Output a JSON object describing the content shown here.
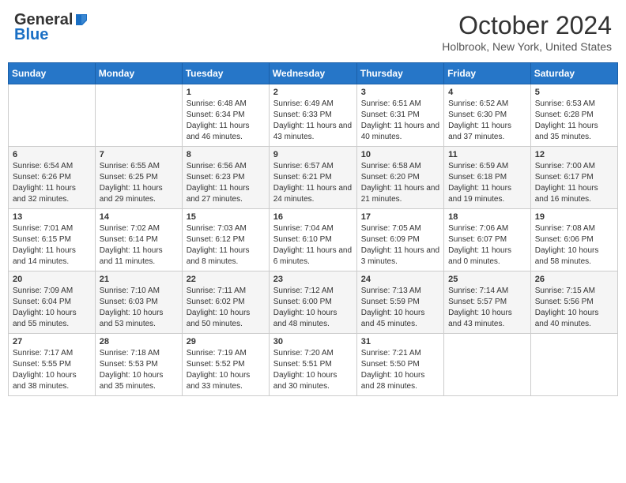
{
  "header": {
    "logo_general": "General",
    "logo_blue": "Blue",
    "title": "October 2024",
    "location": "Holbrook, New York, United States"
  },
  "weekdays": [
    "Sunday",
    "Monday",
    "Tuesday",
    "Wednesday",
    "Thursday",
    "Friday",
    "Saturday"
  ],
  "weeks": [
    [
      {
        "day": "",
        "info": ""
      },
      {
        "day": "",
        "info": ""
      },
      {
        "day": "1",
        "info": "Sunrise: 6:48 AM\nSunset: 6:34 PM\nDaylight: 11 hours and 46 minutes."
      },
      {
        "day": "2",
        "info": "Sunrise: 6:49 AM\nSunset: 6:33 PM\nDaylight: 11 hours and 43 minutes."
      },
      {
        "day": "3",
        "info": "Sunrise: 6:51 AM\nSunset: 6:31 PM\nDaylight: 11 hours and 40 minutes."
      },
      {
        "day": "4",
        "info": "Sunrise: 6:52 AM\nSunset: 6:30 PM\nDaylight: 11 hours and 37 minutes."
      },
      {
        "day": "5",
        "info": "Sunrise: 6:53 AM\nSunset: 6:28 PM\nDaylight: 11 hours and 35 minutes."
      }
    ],
    [
      {
        "day": "6",
        "info": "Sunrise: 6:54 AM\nSunset: 6:26 PM\nDaylight: 11 hours and 32 minutes."
      },
      {
        "day": "7",
        "info": "Sunrise: 6:55 AM\nSunset: 6:25 PM\nDaylight: 11 hours and 29 minutes."
      },
      {
        "day": "8",
        "info": "Sunrise: 6:56 AM\nSunset: 6:23 PM\nDaylight: 11 hours and 27 minutes."
      },
      {
        "day": "9",
        "info": "Sunrise: 6:57 AM\nSunset: 6:21 PM\nDaylight: 11 hours and 24 minutes."
      },
      {
        "day": "10",
        "info": "Sunrise: 6:58 AM\nSunset: 6:20 PM\nDaylight: 11 hours and 21 minutes."
      },
      {
        "day": "11",
        "info": "Sunrise: 6:59 AM\nSunset: 6:18 PM\nDaylight: 11 hours and 19 minutes."
      },
      {
        "day": "12",
        "info": "Sunrise: 7:00 AM\nSunset: 6:17 PM\nDaylight: 11 hours and 16 minutes."
      }
    ],
    [
      {
        "day": "13",
        "info": "Sunrise: 7:01 AM\nSunset: 6:15 PM\nDaylight: 11 hours and 14 minutes."
      },
      {
        "day": "14",
        "info": "Sunrise: 7:02 AM\nSunset: 6:14 PM\nDaylight: 11 hours and 11 minutes."
      },
      {
        "day": "15",
        "info": "Sunrise: 7:03 AM\nSunset: 6:12 PM\nDaylight: 11 hours and 8 minutes."
      },
      {
        "day": "16",
        "info": "Sunrise: 7:04 AM\nSunset: 6:10 PM\nDaylight: 11 hours and 6 minutes."
      },
      {
        "day": "17",
        "info": "Sunrise: 7:05 AM\nSunset: 6:09 PM\nDaylight: 11 hours and 3 minutes."
      },
      {
        "day": "18",
        "info": "Sunrise: 7:06 AM\nSunset: 6:07 PM\nDaylight: 11 hours and 0 minutes."
      },
      {
        "day": "19",
        "info": "Sunrise: 7:08 AM\nSunset: 6:06 PM\nDaylight: 10 hours and 58 minutes."
      }
    ],
    [
      {
        "day": "20",
        "info": "Sunrise: 7:09 AM\nSunset: 6:04 PM\nDaylight: 10 hours and 55 minutes."
      },
      {
        "day": "21",
        "info": "Sunrise: 7:10 AM\nSunset: 6:03 PM\nDaylight: 10 hours and 53 minutes."
      },
      {
        "day": "22",
        "info": "Sunrise: 7:11 AM\nSunset: 6:02 PM\nDaylight: 10 hours and 50 minutes."
      },
      {
        "day": "23",
        "info": "Sunrise: 7:12 AM\nSunset: 6:00 PM\nDaylight: 10 hours and 48 minutes."
      },
      {
        "day": "24",
        "info": "Sunrise: 7:13 AM\nSunset: 5:59 PM\nDaylight: 10 hours and 45 minutes."
      },
      {
        "day": "25",
        "info": "Sunrise: 7:14 AM\nSunset: 5:57 PM\nDaylight: 10 hours and 43 minutes."
      },
      {
        "day": "26",
        "info": "Sunrise: 7:15 AM\nSunset: 5:56 PM\nDaylight: 10 hours and 40 minutes."
      }
    ],
    [
      {
        "day": "27",
        "info": "Sunrise: 7:17 AM\nSunset: 5:55 PM\nDaylight: 10 hours and 38 minutes."
      },
      {
        "day": "28",
        "info": "Sunrise: 7:18 AM\nSunset: 5:53 PM\nDaylight: 10 hours and 35 minutes."
      },
      {
        "day": "29",
        "info": "Sunrise: 7:19 AM\nSunset: 5:52 PM\nDaylight: 10 hours and 33 minutes."
      },
      {
        "day": "30",
        "info": "Sunrise: 7:20 AM\nSunset: 5:51 PM\nDaylight: 10 hours and 30 minutes."
      },
      {
        "day": "31",
        "info": "Sunrise: 7:21 AM\nSunset: 5:50 PM\nDaylight: 10 hours and 28 minutes."
      },
      {
        "day": "",
        "info": ""
      },
      {
        "day": "",
        "info": ""
      }
    ]
  ]
}
